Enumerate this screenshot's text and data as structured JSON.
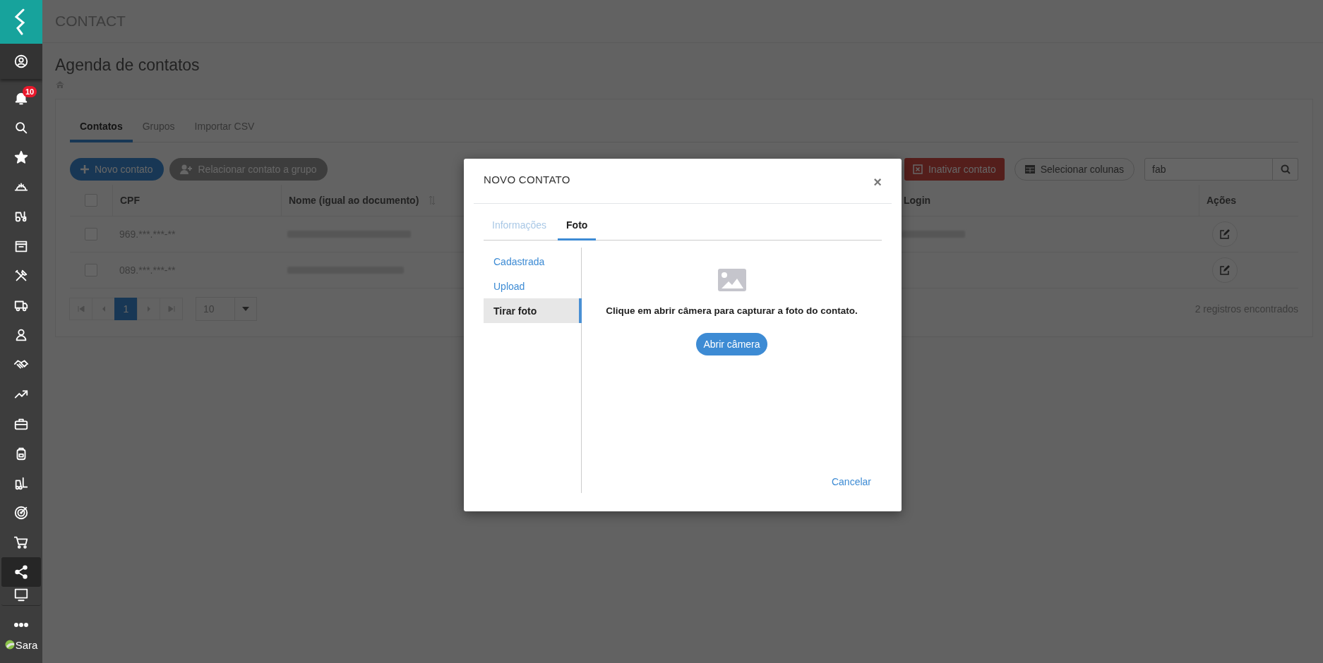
{
  "sidebar": {
    "items": [
      {
        "selected": false
      },
      {
        "selected": false,
        "badge": "10"
      },
      {
        "selected": false
      },
      {
        "selected": false
      },
      {
        "selected": false
      },
      {
        "selected": false
      },
      {
        "selected": false
      },
      {
        "selected": false
      },
      {
        "selected": false
      },
      {
        "selected": false
      },
      {
        "selected": false
      },
      {
        "selected": false
      },
      {
        "selected": false
      },
      {
        "selected": false
      },
      {
        "selected": false
      },
      {
        "selected": false
      },
      {
        "selected": false
      },
      {
        "selected": true
      },
      {
        "selected": false
      },
      {
        "selected": false
      }
    ],
    "user": "Sara"
  },
  "page": {
    "header": "CONTACT",
    "title": "Agenda de contatos"
  },
  "tabs": [
    {
      "label": "Contatos",
      "selected": true
    },
    {
      "label": "Grupos",
      "selected": false
    },
    {
      "label": "Importar CSV",
      "selected": false
    }
  ],
  "toolbar": {
    "new_button": "Novo contato",
    "relate_button": "Relacionar contato a grupo",
    "inactivate_button": "Inativar contato",
    "columns_button": "Selecionar colunas",
    "search": {
      "value": "fab"
    }
  },
  "table": {
    "all_checked": false,
    "columns": [
      "CPF",
      "Nome (igual ao documento)",
      "Login",
      "Ações"
    ],
    "rows": [
      {
        "checked": false,
        "cpf": "969.***.***-**",
        "name_blurred": true,
        "login_blurred": true
      },
      {
        "checked": false,
        "cpf": "089.***.***-**",
        "name_blurred": true
      }
    ]
  },
  "pagination": {
    "pages": [
      {
        "label": "1",
        "selected": true
      }
    ],
    "page_size": "10",
    "total": "2 registros encontrados"
  },
  "modal": {
    "title": "NOVO CONTATO",
    "close": "×",
    "tabs": [
      {
        "label": "Informações",
        "selected": false
      },
      {
        "label": "Foto",
        "selected": true
      }
    ],
    "nav": [
      {
        "label": "Cadastrada",
        "selected": false
      },
      {
        "label": "Upload",
        "selected": false
      },
      {
        "label": "Tirar foto",
        "selected": true
      }
    ],
    "message": "Clique em abrir câmera para capturar a foto do contato.",
    "camera_button": "Abrir câmera",
    "cancel": "Cancelar"
  }
}
